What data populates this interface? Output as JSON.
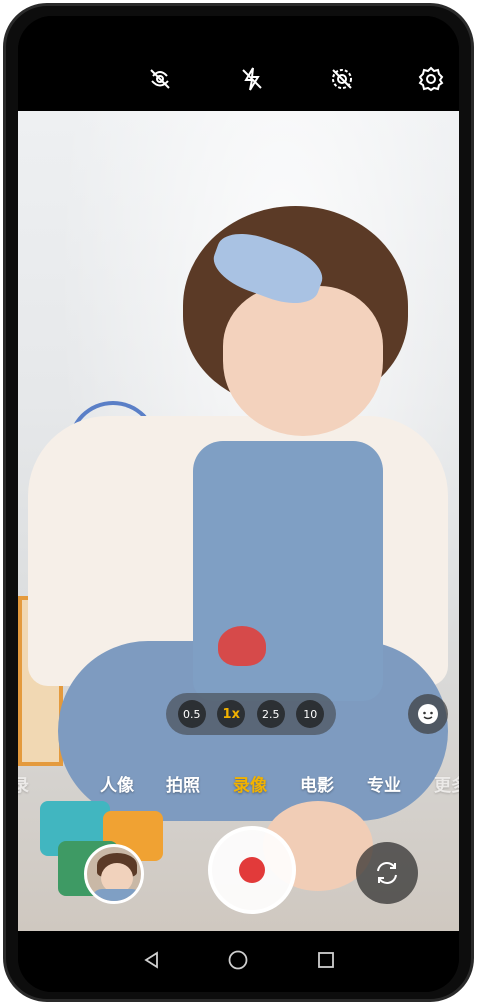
{
  "status_icons": [
    "ai-off-icon",
    "flash-off-icon",
    "live-photo-off-icon",
    "settings-gear-icon"
  ],
  "zoom": {
    "levels": [
      "0.5",
      "1x",
      "2.5",
      "10"
    ],
    "active": "1x"
  },
  "modes": {
    "partial_left": "录",
    "items": [
      "人像",
      "拍照",
      "录像",
      "电影",
      "专业"
    ],
    "active": "录像",
    "partial_right": "更多"
  },
  "colors": {
    "accent": "#f2b200",
    "record_red": "#e23a3a"
  },
  "nav": [
    "back-triangle-icon",
    "home-circle-icon",
    "recents-square-icon"
  ]
}
